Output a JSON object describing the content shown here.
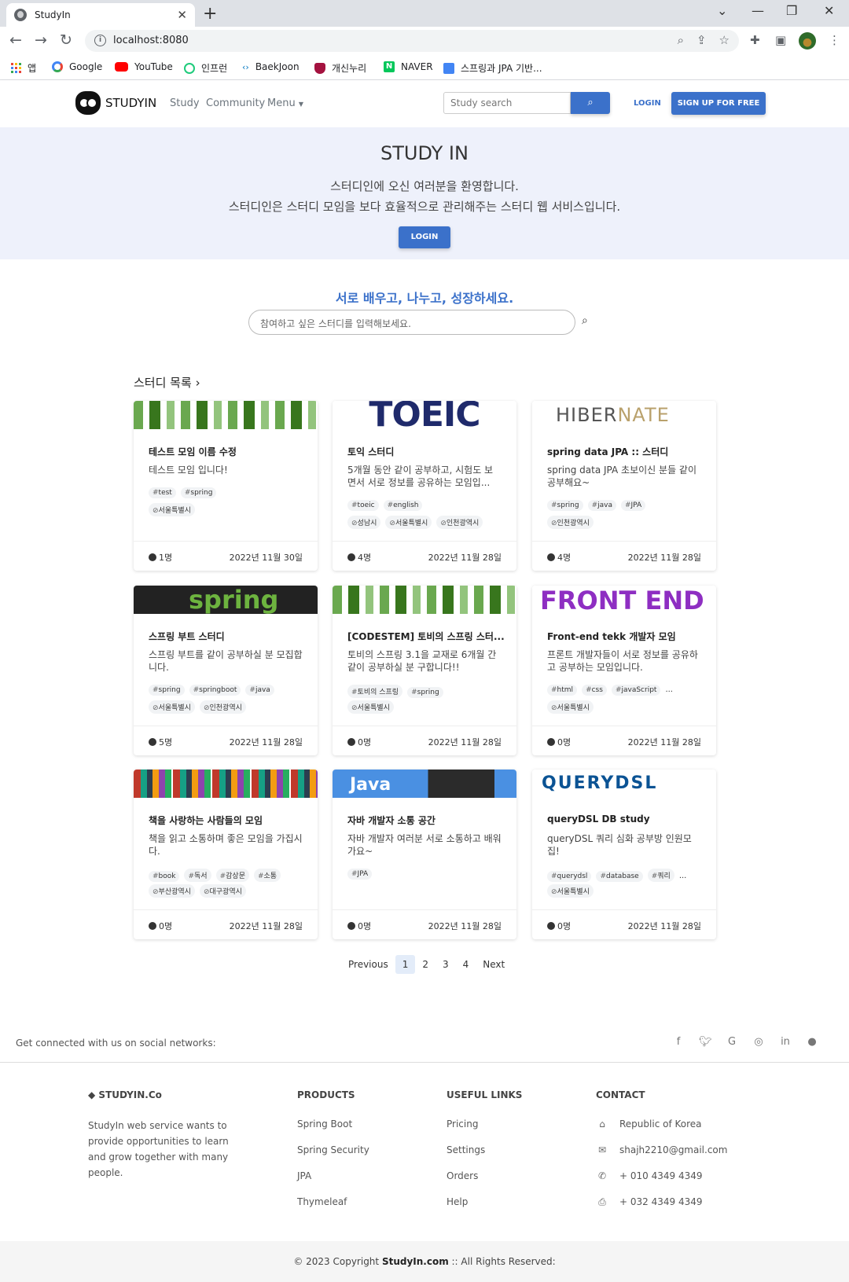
{
  "browser": {
    "tab_title": "StudyIn",
    "url": "localhost:8080",
    "bookmarks": [
      "앱",
      "Google",
      "YouTube",
      "인프런",
      "BaekJoon",
      "개신누리",
      "NAVER",
      "스프링과 JPA 기반..."
    ]
  },
  "nav": {
    "brand": "STUDYIN",
    "links": [
      "Study",
      "Community",
      "Menu"
    ],
    "search_placeholder": "Study search",
    "login": "LOGIN",
    "signup": "SIGN UP FOR FREE"
  },
  "hero": {
    "title": "STUDY IN",
    "line1": "스터디인에 오신 여러분을 환영합니다.",
    "line2": "스터디인은 스터디 모임을 보다 효율적으로 관리해주는 스터디 웹 서비스입니다.",
    "button": "LOGIN"
  },
  "search": {
    "tagline": "서로 배우고, 나누고, 성장하세요.",
    "placeholder": "참여하고 싶은 스터디를 입력해보세요."
  },
  "list_title": "스터디 목록",
  "cards": [
    {
      "image": "pattern",
      "title": "테스트 모임 이름 수정",
      "desc": "테스트 모임 입니다!",
      "tags": [
        "test",
        "spring"
      ],
      "locations": [
        "서울특별시"
      ],
      "members": "1명",
      "date": "2022년 11월 30일"
    },
    {
      "image": "toeic",
      "image_text": "TOEIC",
      "title": "토익 스터디",
      "desc": "5개월 동안 같이 공부하고, 시험도 보면서 서로 정보를 공유하는 모임입...",
      "tags": [
        "toeic",
        "english"
      ],
      "locations": [
        "성남시",
        "서울특별시",
        "인천광역시"
      ],
      "members": "4명",
      "date": "2022년 11월 28일"
    },
    {
      "image": "hibernate",
      "image_text_a": "HIBER",
      "image_text_b": "NATE",
      "title": "spring data JPA :: 스터디",
      "desc": "spring data JPA 초보이신 분들 같이 공부해요~",
      "tags": [
        "spring",
        "java",
        "JPA"
      ],
      "locations": [
        "인천광역시"
      ],
      "members": "4명",
      "date": "2022년 11월 28일"
    },
    {
      "image": "spring",
      "image_text": "spring",
      "title": "스프링 부트 스터디",
      "desc": "스프링 부트를 같이 공부하실 분 모집합니다.",
      "tags": [
        "spring",
        "springboot",
        "java"
      ],
      "locations": [
        "서울특별시",
        "인천광역시"
      ],
      "members": "5명",
      "date": "2022년 11월 28일"
    },
    {
      "image": "pattern",
      "title": "[CODESTEM] 토비의 스프링 스터...",
      "desc": "토비의 스프링 3.1을 교재로 6개월 간 같이 공부하실 분 구합니다!!",
      "tags": [
        "토비의 스프링",
        "spring"
      ],
      "locations": [
        "서울특별시"
      ],
      "members": "0명",
      "date": "2022년 11월 28일"
    },
    {
      "image": "front",
      "image_text": "FRONT END",
      "title": "Front-end tekk 개발자 모임",
      "desc": "프론트 개발자들이 서로 정보를 공유하고 공부하는 모임입니다.",
      "tags": [
        "html",
        "css",
        "javaScript"
      ],
      "more": "...",
      "locations": [
        "서울특별시"
      ],
      "members": "0명",
      "date": "2022년 11월 28일"
    },
    {
      "image": "books",
      "title": "책을 사랑하는 사람들의 모임",
      "desc": "책을 읽고 소통하며 좋은 모임을 가집시다.",
      "tags": [
        "book",
        "독서",
        "감상문",
        "소통"
      ],
      "locations": [
        "부산광역시",
        "대구광역시"
      ],
      "members": "0명",
      "date": "2022년 11월 28일"
    },
    {
      "image": "java",
      "image_text": "Java",
      "title": "자바 개발자 소통 공간",
      "desc": "자바 개발자 여러분 서로 소통하고 배워가요~",
      "tags": [
        "JPA"
      ],
      "locations": [],
      "members": "0명",
      "date": "2022년 11월 28일"
    },
    {
      "image": "qdsl",
      "image_text": "QUERYDSL",
      "title": "queryDSL DB study",
      "desc": "queryDSL 쿼리 심화 공부방 인원모집!",
      "tags": [
        "querydsl",
        "database",
        "쿼리"
      ],
      "more": "...",
      "locations": [
        "서울특별시"
      ],
      "members": "0명",
      "date": "2022년 11월 28일"
    }
  ],
  "pagination": {
    "prev": "Previous",
    "pages": [
      "1",
      "2",
      "3",
      "4"
    ],
    "active": "1",
    "next": "Next"
  },
  "footer": {
    "social_text": "Get connected with us on social networks:",
    "brand": "STUDYIN.Co",
    "about": "StudyIn web service wants to provide opportunities to learn and grow together with many people.",
    "products_head": "PRODUCTS",
    "products": [
      "Spring Boot",
      "Spring Security",
      "JPA",
      "Thymeleaf"
    ],
    "links_head": "USEFUL LINKS",
    "links": [
      "Pricing",
      "Settings",
      "Orders",
      "Help"
    ],
    "contact_head": "CONTACT",
    "contact": [
      {
        "icon": "home-icon",
        "text": "Republic of Korea"
      },
      {
        "icon": "envelope-icon",
        "text": "shajh2210@gmail.com"
      },
      {
        "icon": "phone-icon",
        "text": "+ 010 4349 4349"
      },
      {
        "icon": "print-icon",
        "text": "+ 032 4349 4349"
      }
    ],
    "copyright_pre": "© 2023 Copyright ",
    "copyright_brand": "StudyIn.com",
    "copyright_post": " :: All Rights Reserved:"
  }
}
